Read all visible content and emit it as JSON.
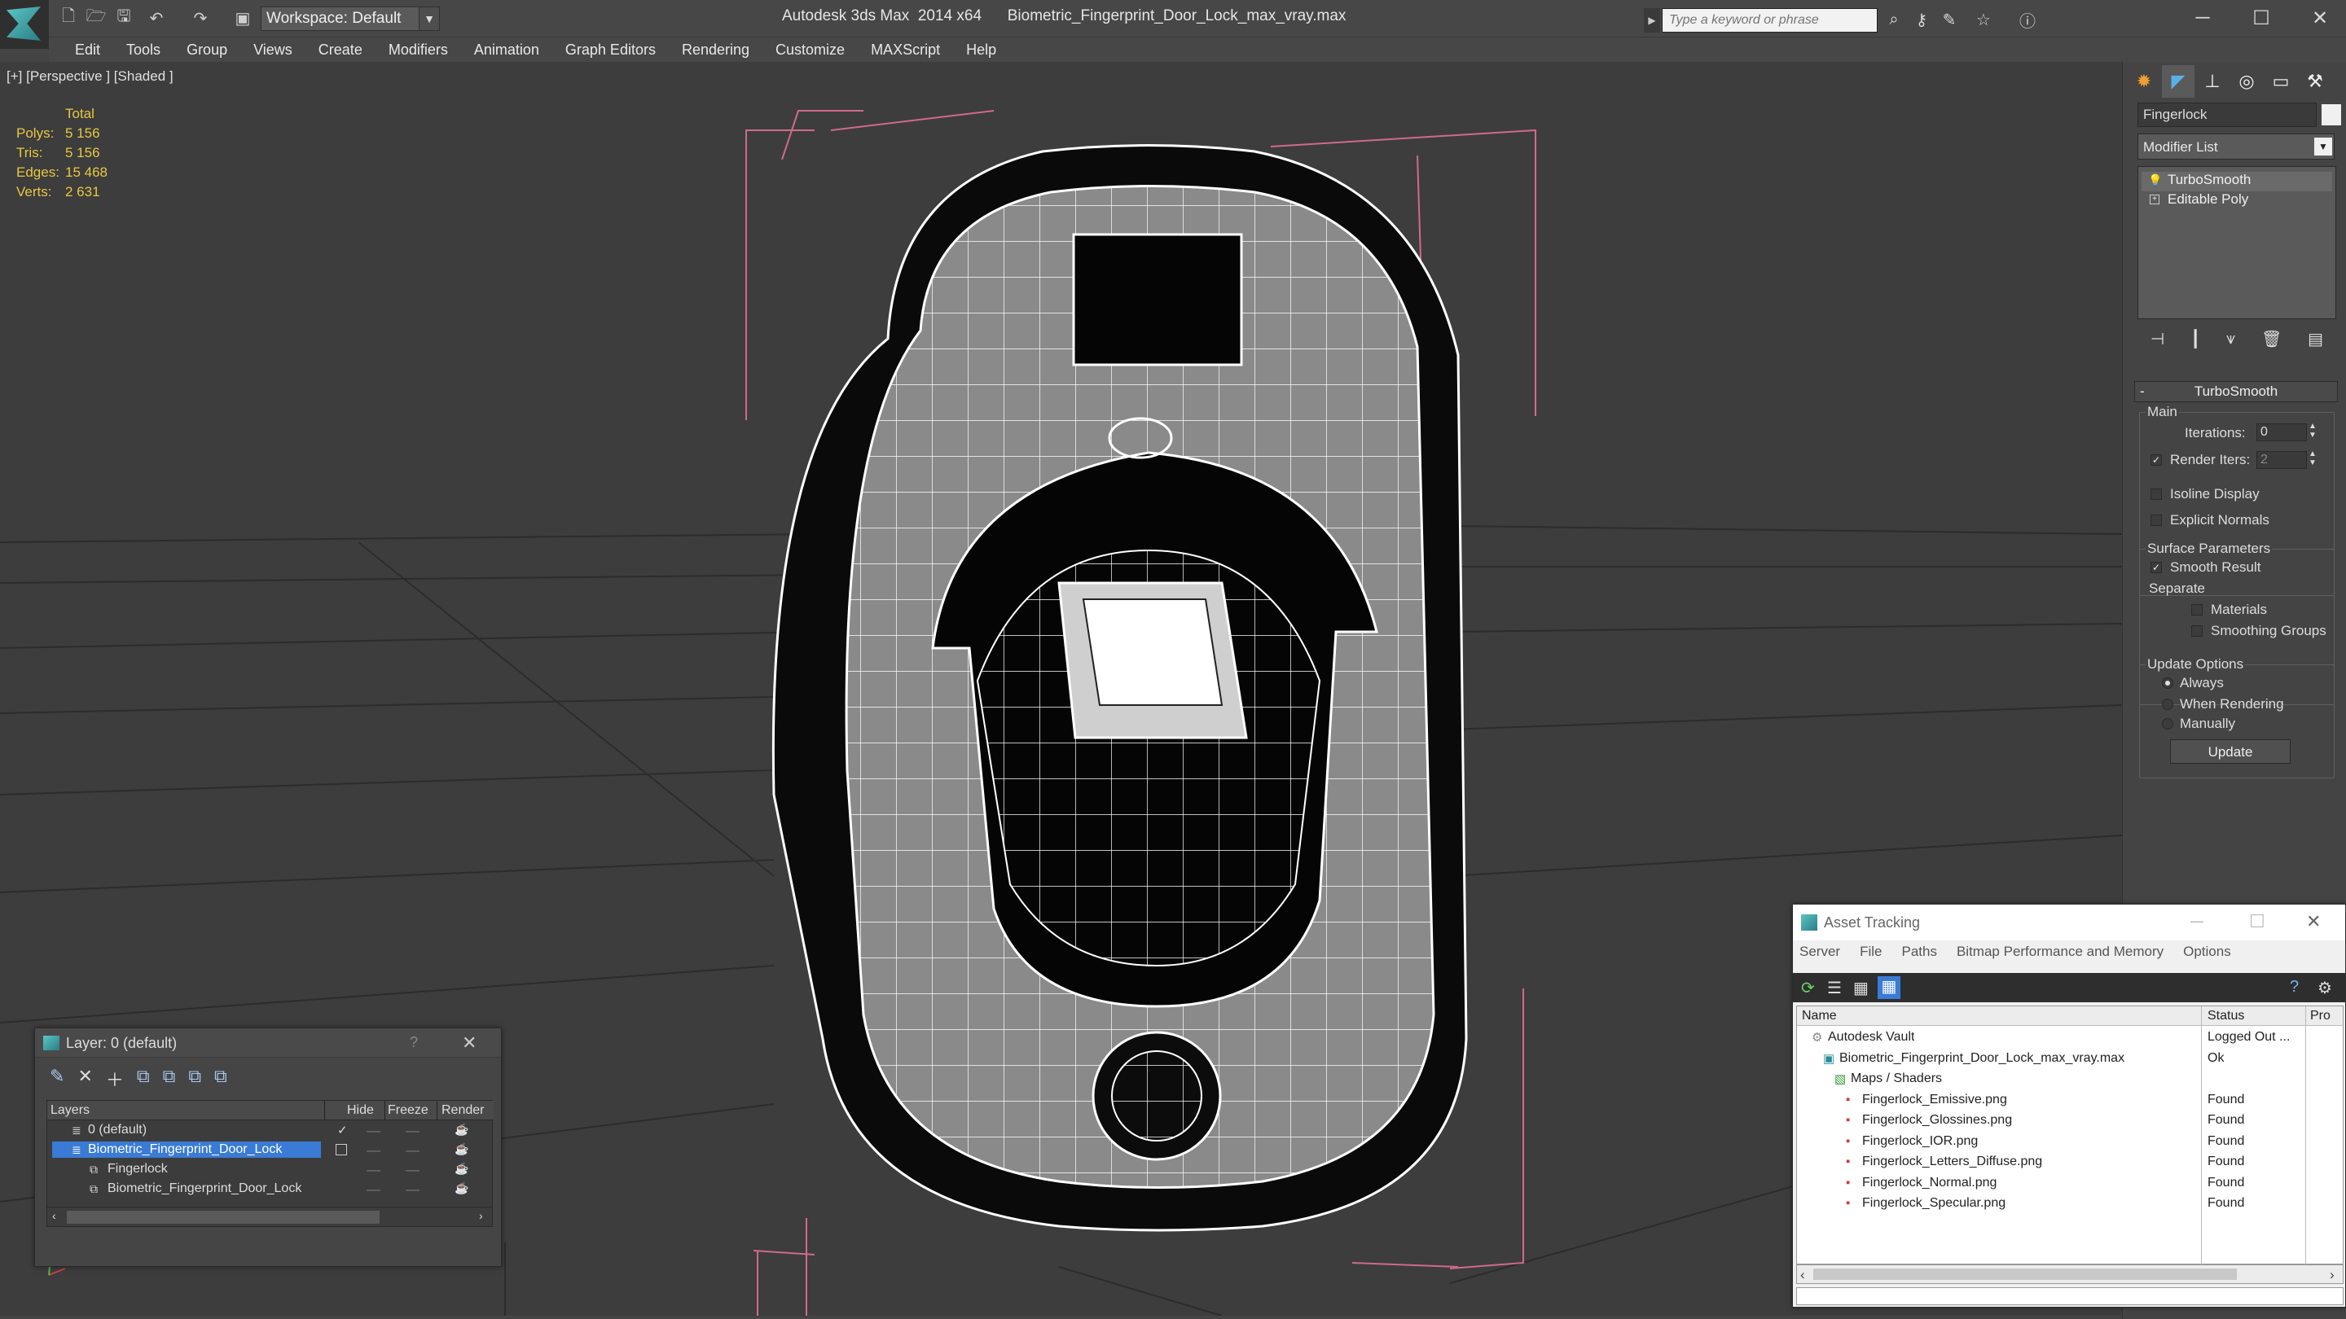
{
  "titlebar": {
    "workspace": "Workspace: Default",
    "app_name": "Autodesk 3ds Max  2014 x64",
    "file_name": "Biometric_Fingerprint_Door_Lock_max_vray.max",
    "search_placeholder": "Type a keyword or phrase"
  },
  "menu": [
    "Edit",
    "Tools",
    "Group",
    "Views",
    "Create",
    "Modifiers",
    "Animation",
    "Graph Editors",
    "Rendering",
    "Customize",
    "MAXScript",
    "Help"
  ],
  "viewport": {
    "label": "[+] [Perspective ] [Shaded ]",
    "stats": {
      "header": "Total",
      "rows": [
        {
          "label": "Polys:",
          "value": "5 156"
        },
        {
          "label": "Tris:",
          "value": "5 156"
        },
        {
          "label": "Edges:",
          "value": "15 468"
        },
        {
          "label": "Verts:",
          "value": "2 631"
        }
      ]
    }
  },
  "command_panel": {
    "object_name": "Fingerlock",
    "modifier_list": "Modifier List",
    "stack": [
      "TurboSmooth",
      "Editable Poly"
    ],
    "rollout_title": "TurboSmooth",
    "main_group": "Main",
    "iterations_label": "Iterations:",
    "iterations_value": "0",
    "render_iters_label": "Render Iters:",
    "render_iters_value": "2",
    "render_iters_checked": true,
    "isoline_label": "Isoline Display",
    "explicit_normals_label": "Explicit Normals",
    "surface_group": "Surface Parameters",
    "smooth_result_label": "Smooth Result",
    "separate_label": "Separate",
    "materials_label": "Materials",
    "smoothing_groups_label": "Smoothing Groups",
    "update_group": "Update Options",
    "update_options": [
      "Always",
      "When Rendering",
      "Manually"
    ],
    "update_selected": "Always",
    "update_button": "Update"
  },
  "layer_window": {
    "title": "Layer: 0 (default)",
    "help": "?",
    "columns": [
      "Layers",
      "Hide",
      "Freeze",
      "Render"
    ],
    "rows": [
      {
        "name": "0 (default)",
        "indent": 0,
        "selected": false
      },
      {
        "name": "Biometric_Fingerprint_Door_Lock",
        "indent": 0,
        "selected": true
      },
      {
        "name": "Fingerlock",
        "indent": 1,
        "selected": false
      },
      {
        "name": "Biometric_Fingerprint_Door_Lock",
        "indent": 1,
        "selected": false
      }
    ]
  },
  "asset_window": {
    "title": "Asset Tracking",
    "menu": [
      "Server",
      "File",
      "Paths",
      "Bitmap Performance and Memory",
      "Options"
    ],
    "columns": [
      "Name",
      "Status",
      "Pro"
    ],
    "rows": [
      {
        "name": "Autodesk Vault",
        "status": "Logged Out ...",
        "indent": 0,
        "icon": "vault-icon"
      },
      {
        "name": "Biometric_Fingerprint_Door_Lock_max_vray.max",
        "status": "Ok",
        "indent": 1,
        "icon": "max-file-icon"
      },
      {
        "name": "Maps / Shaders",
        "status": "",
        "indent": 2,
        "icon": "maps-icon"
      },
      {
        "name": "Fingerlock_Emissive.png",
        "status": "Found",
        "indent": 3,
        "icon": "png-icon"
      },
      {
        "name": "Fingerlock_Glossines.png",
        "status": "Found",
        "indent": 3,
        "icon": "png-icon"
      },
      {
        "name": "Fingerlock_IOR.png",
        "status": "Found",
        "indent": 3,
        "icon": "png-icon"
      },
      {
        "name": "Fingerlock_Letters_Diffuse.png",
        "status": "Found",
        "indent": 3,
        "icon": "png-icon"
      },
      {
        "name": "Fingerlock_Normal.png",
        "status": "Found",
        "indent": 3,
        "icon": "png-icon"
      },
      {
        "name": "Fingerlock_Specular.png",
        "status": "Found",
        "indent": 3,
        "icon": "png-icon"
      }
    ]
  },
  "colors": {
    "selection_blue": "#3a7bd5",
    "stats_yellow": "#e8c840",
    "bounding_box_pink": "#d06a8a"
  }
}
